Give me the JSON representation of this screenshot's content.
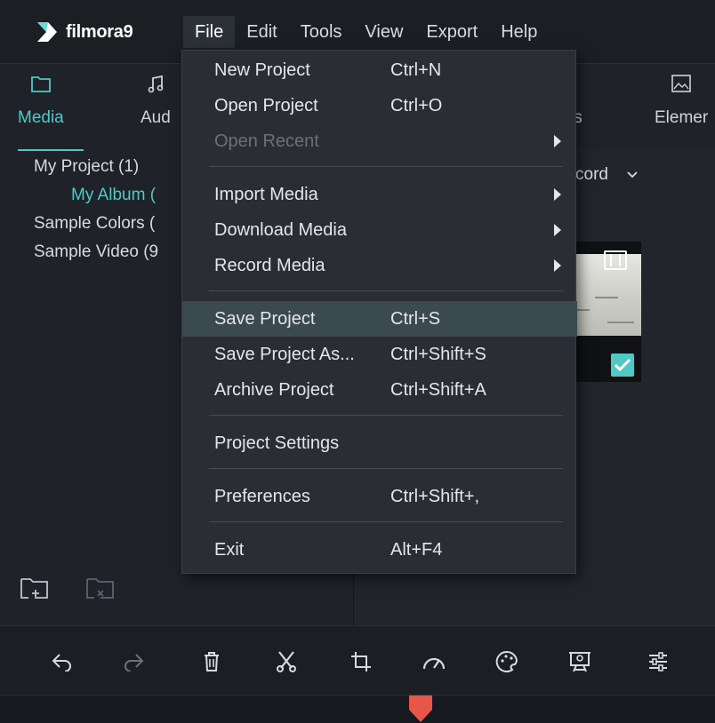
{
  "app": {
    "logo_text": "filmora9",
    "accent_color": "#4fc9c4"
  },
  "menubar": {
    "items": [
      "File",
      "Edit",
      "Tools",
      "View",
      "Export",
      "Help"
    ]
  },
  "tabs": {
    "media": "Media",
    "audio": "Aud",
    "effects": "ts",
    "elements": "Elemer"
  },
  "tree": {
    "nodes": [
      "My Project (1)",
      "My Album (",
      "Sample Colors (",
      "Sample Video (9"
    ]
  },
  "content": {
    "record_label": "cord"
  },
  "file_menu": {
    "items": [
      {
        "label": "New Project",
        "shortcut": "Ctrl+N"
      },
      {
        "label": "Open Project",
        "shortcut": "Ctrl+O"
      },
      {
        "label": "Open Recent",
        "shortcut": ""
      },
      {
        "label": "Import Media",
        "shortcut": ""
      },
      {
        "label": "Download Media",
        "shortcut": ""
      },
      {
        "label": "Record Media",
        "shortcut": ""
      },
      {
        "label": "Save Project",
        "shortcut": "Ctrl+S"
      },
      {
        "label": "Save Project As...",
        "shortcut": "Ctrl+Shift+S"
      },
      {
        "label": "Archive Project",
        "shortcut": "Ctrl+Shift+A"
      },
      {
        "label": "Project Settings",
        "shortcut": ""
      },
      {
        "label": "Preferences",
        "shortcut": "Ctrl+Shift+,"
      },
      {
        "label": "Exit",
        "shortcut": "Alt+F4"
      }
    ]
  },
  "toolbar": {
    "icons": [
      "undo-icon",
      "redo-icon",
      "delete-icon",
      "cut-icon",
      "crop-icon",
      "speed-icon",
      "color-icon",
      "green-screen-icon",
      "audio-mixer-icon"
    ]
  }
}
